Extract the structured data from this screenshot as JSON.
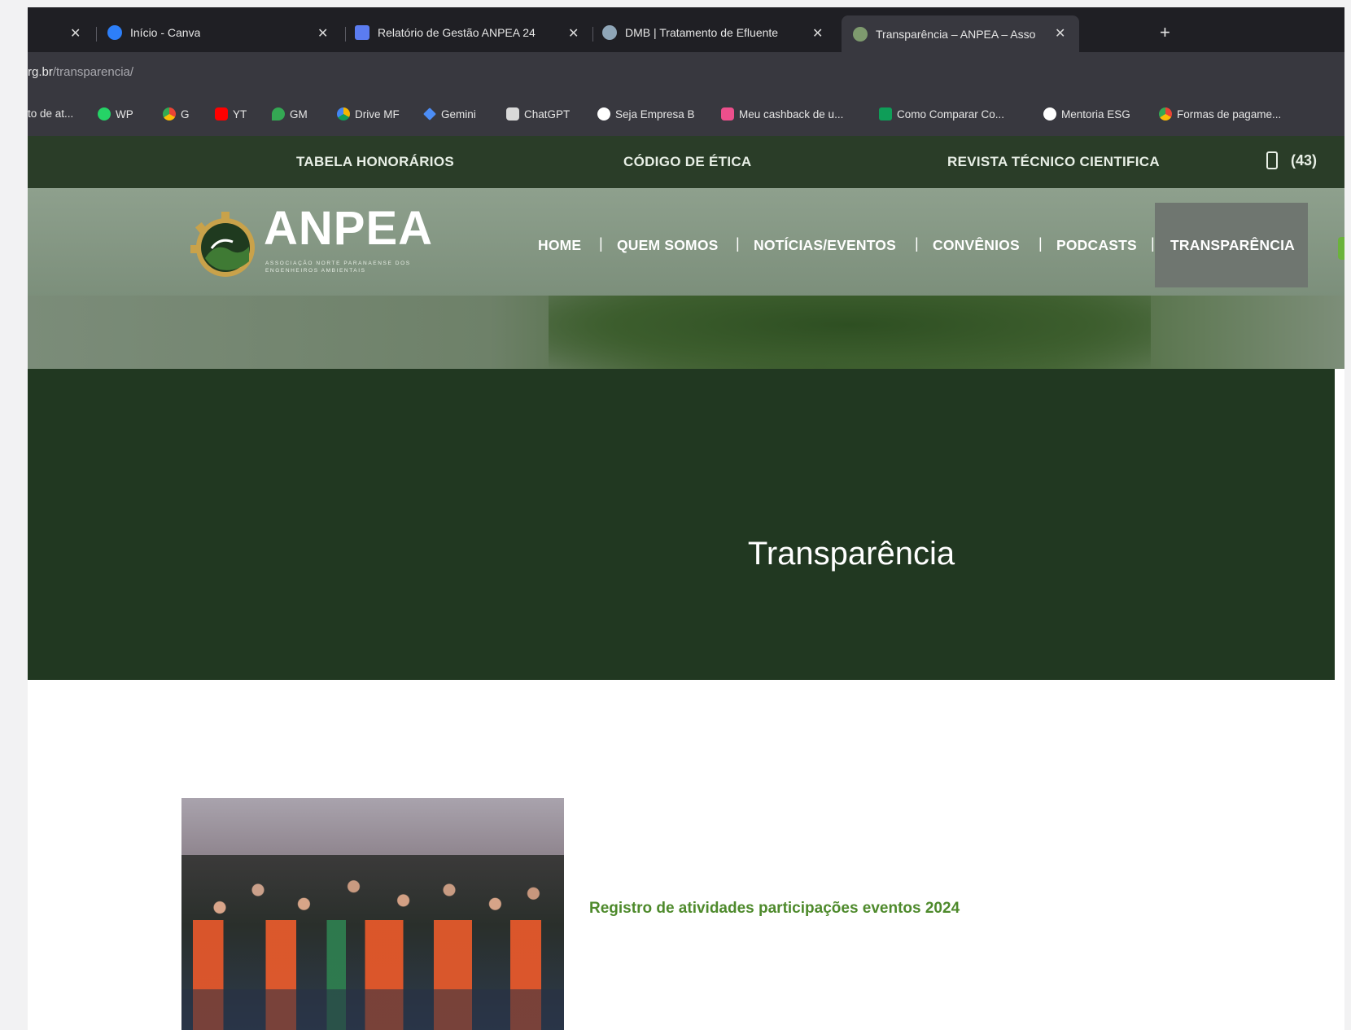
{
  "browser": {
    "tabs": [
      {
        "title": "",
        "closable": true
      },
      {
        "title": "Início - Canva",
        "closable": true
      },
      {
        "title": "Relatório de Gestão ANPEA 24",
        "closable": true
      },
      {
        "title": "DMB | Tratamento de Efluente",
        "closable": true
      },
      {
        "title": "Transparência – ANPEA – Asso",
        "closable": true,
        "active": true
      }
    ],
    "close_glyph": "✕",
    "new_tab_glyph": "+",
    "url_domain": "rg.br",
    "url_path": "/transparencia/",
    "bookmarks": [
      {
        "label": "to de at...",
        "icon": "folder-icon",
        "color": "#7a7a7a"
      },
      {
        "label": "WP",
        "icon": "whatsapp-icon",
        "color": "#25d366"
      },
      {
        "label": "G",
        "icon": "chrome-icon",
        "color": "#e0b23c"
      },
      {
        "label": "YT",
        "icon": "youtube-icon",
        "color": "#ff0000"
      },
      {
        "label": "GM",
        "icon": "google-maps-icon",
        "color": "#34a853"
      },
      {
        "label": "Drive MF",
        "icon": "google-drive-icon",
        "color": "#f4b400"
      },
      {
        "label": "Gemini",
        "icon": "gemini-icon",
        "color": "#4c8df6"
      },
      {
        "label": "ChatGPT",
        "icon": "chatgpt-icon",
        "color": "#d9d9d9"
      },
      {
        "label": "Seja Empresa B",
        "icon": "globe-icon",
        "color": "#ffffff"
      },
      {
        "label": "Meu cashback de u...",
        "icon": "cashback-icon",
        "color": "#ec4f8c"
      },
      {
        "label": "Como Comparar Co...",
        "icon": "spreadsheet-icon",
        "color": "#0f9d58"
      },
      {
        "label": "Mentoria ESG",
        "icon": "globe-icon",
        "color": "#ffffff"
      },
      {
        "label": "Formas de pagame...",
        "icon": "chrome-icon",
        "color": "#e0b23c"
      }
    ]
  },
  "site": {
    "top_links": [
      "TABELA HONORÁRIOS",
      "CÓDIGO DE ÉTICA",
      "REVISTA TÉCNICO CIENTIFICA"
    ],
    "phone": "(43)",
    "brand": "ANPEA",
    "brand_subtitle": "ASSOCIAÇÃO NORTE PARANAENSE DOS ENGENHEIROS AMBIENTAIS",
    "nav": [
      "HOME",
      "QUEM SOMOS",
      "NOTÍCIAS/EVENTOS",
      "CONVÊNIOS",
      "PODCASTS",
      "TRANSPARÊNCIA"
    ],
    "nav_separator": "|",
    "active_nav": "TRANSPARÊNCIA",
    "hero_title": "Transparência",
    "post_caption": "Registro de atividades participações eventos 2024",
    "colors": {
      "topbar": "#2a3d28",
      "hero": "#213821",
      "accent_green": "#4e8a2c",
      "logo_gold": "#c9a24a"
    }
  }
}
